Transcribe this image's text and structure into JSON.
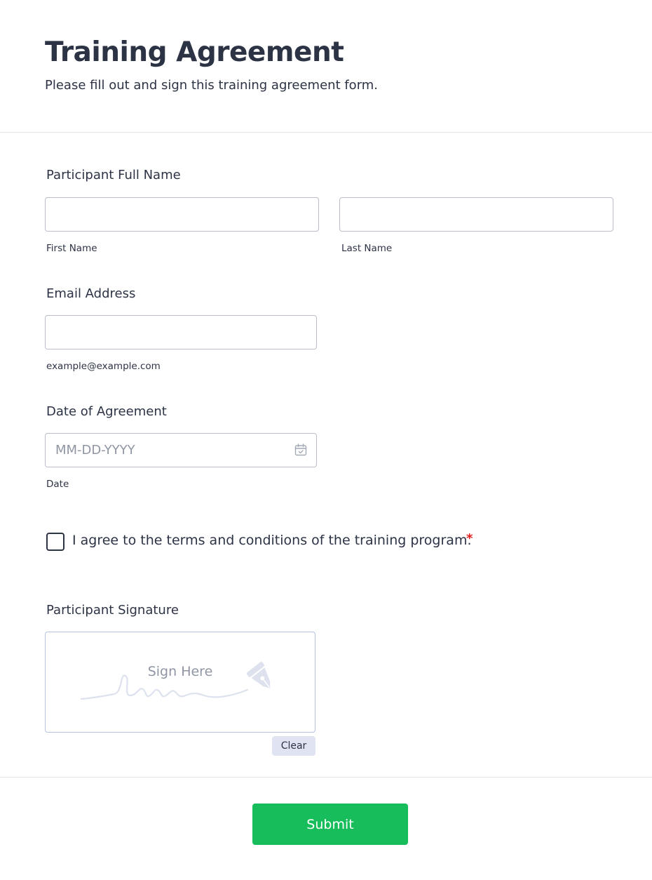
{
  "header": {
    "title": "Training Agreement",
    "subtitle": "Please fill out and sign this training agreement form."
  },
  "full_name": {
    "label": "Participant Full Name",
    "first_value": "",
    "first_sublabel": "First Name",
    "last_value": "",
    "last_sublabel": "Last Name"
  },
  "email": {
    "label": "Email Address",
    "value": "",
    "sublabel": "example@example.com"
  },
  "date": {
    "label": "Date of Agreement",
    "placeholder": "MM-DD-YYYY",
    "sublabel": "Date",
    "icon": "calendar-icon"
  },
  "agreement": {
    "label": "I agree to the terms and conditions of the training program.",
    "required_mark": "*",
    "checked": false
  },
  "signature": {
    "label": "Participant Signature",
    "placeholder": "Sign Here",
    "icon": "pen-nib-icon",
    "clear_label": "Clear"
  },
  "footer": {
    "submit_label": "Submit"
  },
  "colors": {
    "text": "#2c3345",
    "submit": "#18bd5b",
    "required": "#e11d1d",
    "clear_bg": "#dfe3f2"
  }
}
